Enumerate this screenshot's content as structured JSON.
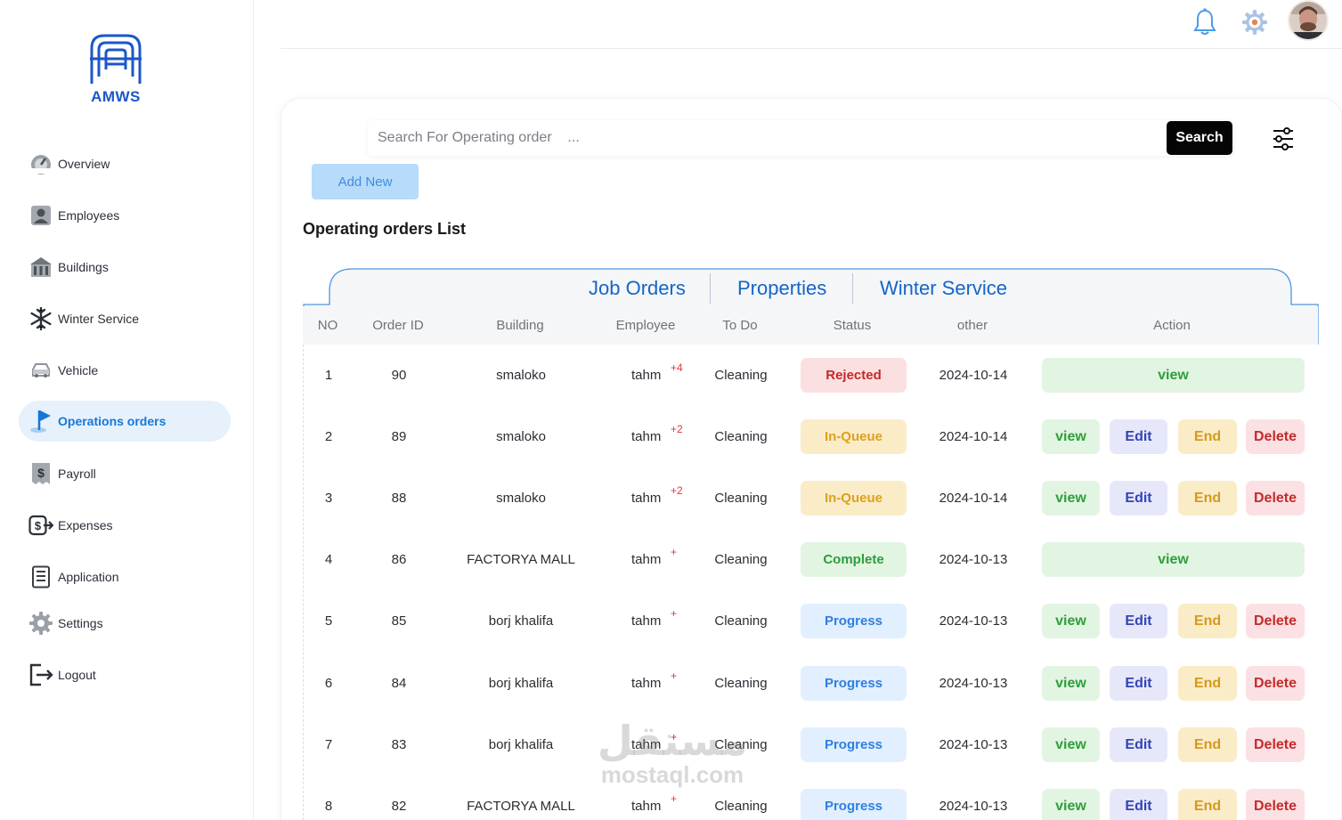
{
  "brand": {
    "name": "AMWS"
  },
  "sidebar": {
    "items": [
      {
        "label": "Overview",
        "icon": "gauge-icon"
      },
      {
        "label": "Employees",
        "icon": "user-badge-icon"
      },
      {
        "label": "Buildings",
        "icon": "building-icon"
      },
      {
        "label": "Winter Service",
        "icon": "snowflake-icon"
      },
      {
        "label": "Vehicle",
        "icon": "car-icon"
      },
      {
        "label": "Operations orders",
        "icon": "flag-icon",
        "active": true
      },
      {
        "label": "Payroll",
        "icon": "dollar-document-icon"
      },
      {
        "label": "Expenses",
        "icon": "money-transfer-icon"
      },
      {
        "label": "Application",
        "icon": "form-icon"
      },
      {
        "label": "Settings",
        "icon": "gear-icon"
      },
      {
        "label": "Logout",
        "icon": "logout-icon"
      }
    ]
  },
  "topbar": {
    "icons": [
      "bell-icon",
      "gear-icon",
      "avatar"
    ]
  },
  "search": {
    "placeholder": "Search For Operating order    ...",
    "button_label": "Search"
  },
  "actions": {
    "add_new_label": "Add New"
  },
  "list_title": "Operating orders List",
  "tabs": [
    {
      "label": "Job Orders"
    },
    {
      "label": "Properties"
    },
    {
      "label": "Winter Service"
    }
  ],
  "table": {
    "columns": [
      "NO",
      "Order ID",
      "Building",
      "Employee",
      "To Do",
      "Status",
      "other",
      "Action"
    ],
    "rows": [
      {
        "no": "1",
        "order_id": "90",
        "building": "smaloko",
        "employee": "tahm",
        "extra": "+4",
        "todo": "Cleaning",
        "status": "Rejected",
        "status_kind": "rejected",
        "date": "2024-10-14",
        "actions": [
          "view"
        ]
      },
      {
        "no": "2",
        "order_id": "89",
        "building": "smaloko",
        "employee": "tahm",
        "extra": "+2",
        "todo": "Cleaning",
        "status": "In-Queue",
        "status_kind": "queue",
        "date": "2024-10-14",
        "actions": [
          "view",
          "Edit",
          "End",
          "Delete"
        ]
      },
      {
        "no": "3",
        "order_id": "88",
        "building": "smaloko",
        "employee": "tahm",
        "extra": "+2",
        "todo": "Cleaning",
        "status": "In-Queue",
        "status_kind": "queue",
        "date": "2024-10-14",
        "actions": [
          "view",
          "Edit",
          "End",
          "Delete"
        ]
      },
      {
        "no": "4",
        "order_id": "86",
        "building": "FACTORYA MALL",
        "employee": "tahm",
        "extra": "+",
        "todo": "Cleaning",
        "status": "Complete",
        "status_kind": "complete",
        "date": "2024-10-13",
        "actions": [
          "view"
        ]
      },
      {
        "no": "5",
        "order_id": "85",
        "building": "borj khalifa",
        "employee": "tahm",
        "extra": "+",
        "todo": "Cleaning",
        "status": "Progress",
        "status_kind": "progress",
        "date": "2024-10-13",
        "actions": [
          "view",
          "Edit",
          "End",
          "Delete"
        ]
      },
      {
        "no": "6",
        "order_id": "84",
        "building": "borj khalifa",
        "employee": "tahm",
        "extra": "+",
        "todo": "Cleaning",
        "status": "Progress",
        "status_kind": "progress",
        "date": "2024-10-13",
        "actions": [
          "view",
          "Edit",
          "End",
          "Delete"
        ]
      },
      {
        "no": "7",
        "order_id": "83",
        "building": "borj khalifa",
        "employee": "tahm",
        "extra": "+",
        "todo": "Cleaning",
        "status": "Progress",
        "status_kind": "progress",
        "date": "2024-10-13",
        "actions": [
          "view",
          "Edit",
          "End",
          "Delete"
        ]
      },
      {
        "no": "8",
        "order_id": "82",
        "building": "FACTORYA MALL",
        "employee": "tahm",
        "extra": "+",
        "todo": "Cleaning",
        "status": "Progress",
        "status_kind": "progress",
        "date": "2024-10-13",
        "actions": [
          "view",
          "Edit",
          "End",
          "Delete"
        ]
      }
    ]
  },
  "watermark": {
    "arabic": "مستقل",
    "latin": "mostaql.com"
  },
  "colors": {
    "accent": "#1677d8",
    "brand": "#1b57c9",
    "active_bg": "#e7f1fc"
  }
}
